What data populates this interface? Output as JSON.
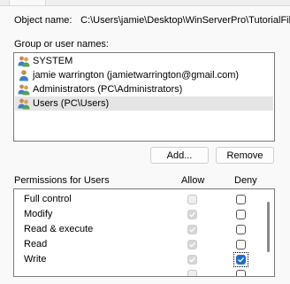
{
  "object": {
    "label": "Object name:",
    "path": "C:\\Users\\jamie\\Desktop\\WinServerPro\\TutorialFile"
  },
  "groups": {
    "label": "Group or user names:",
    "users": [
      {
        "name": "SYSTEM",
        "icon": "group-users-icon",
        "selected": false
      },
      {
        "name": "jamie warrington (jamietwarrington@gmail.com)",
        "icon": "user-icon",
        "selected": false
      },
      {
        "name": "Administrators (PC\\Administrators)",
        "icon": "group-users-icon",
        "selected": false
      },
      {
        "name": "Users (PC\\Users)",
        "icon": "group-users-icon",
        "selected": true
      }
    ]
  },
  "buttons": {
    "add": "Add...",
    "remove": "Remove"
  },
  "permissions": {
    "header": "Permissions for Users",
    "allow_label": "Allow",
    "deny_label": "Deny",
    "rows": [
      {
        "name": "Full control",
        "allow": false,
        "deny": false
      },
      {
        "name": "Modify",
        "allow": true,
        "deny": false
      },
      {
        "name": "Read & execute",
        "allow": true,
        "deny": false
      },
      {
        "name": "Read",
        "allow": true,
        "deny": false
      },
      {
        "name": "Write",
        "allow": true,
        "deny": true
      }
    ]
  },
  "colors": {
    "checked_accent": "#1f6cd0",
    "selection": "#e5e5e5"
  }
}
